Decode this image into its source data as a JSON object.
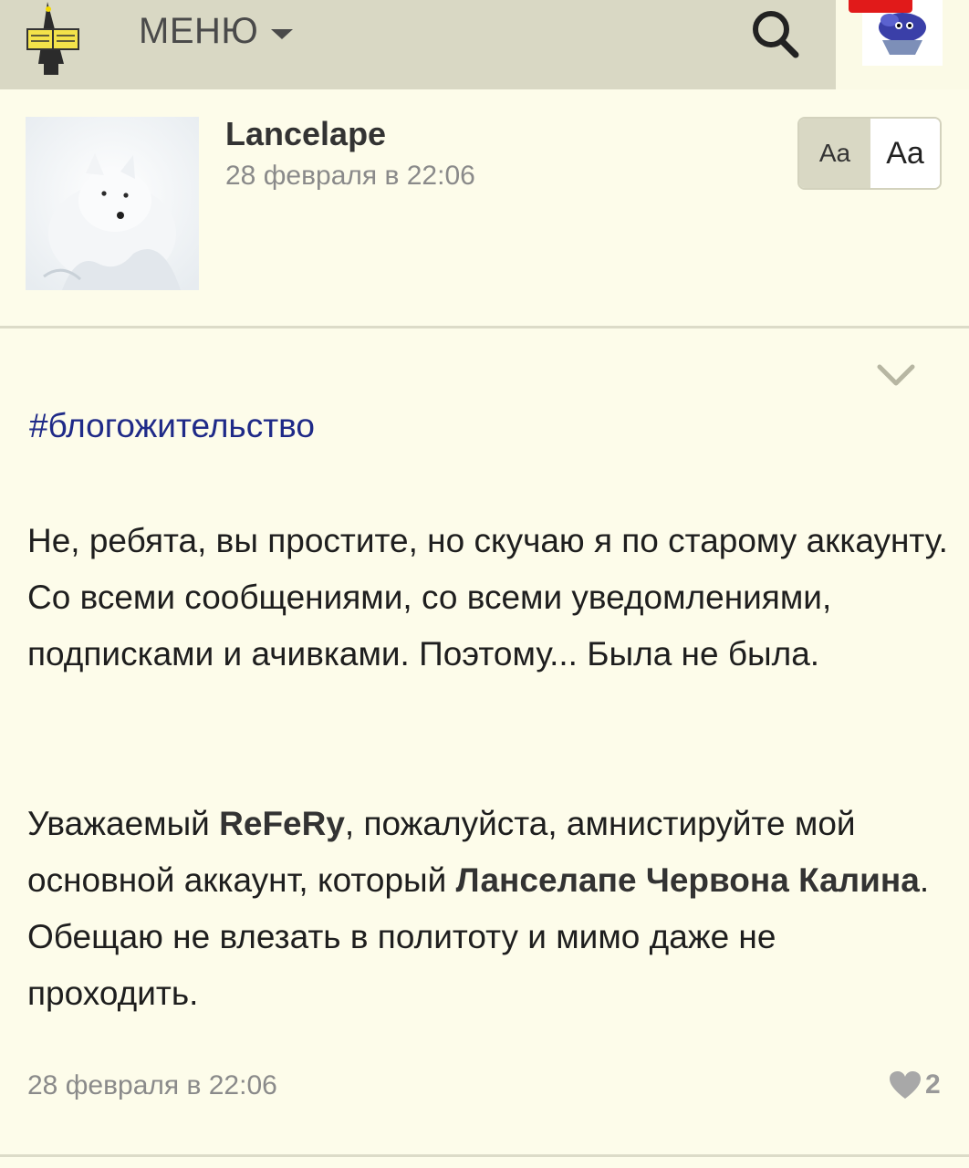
{
  "header": {
    "menu_label": "МЕНЮ",
    "icons": {
      "logo": "wizard-reading-logo-icon",
      "menu_caret": "chevron-down-icon",
      "search": "search-icon",
      "user_avatar": "user-avatar-icon"
    },
    "colors": {
      "bar": "#d9d8c4",
      "badge": "#e11a1a"
    }
  },
  "post": {
    "author": "Lancelape",
    "date": "28 февраля в 22:06",
    "font_toggle": {
      "small": "Aa",
      "large": "Aa",
      "selected": "large"
    },
    "hashtag": "#блогожительство",
    "paragraph1": "Не, ребята, вы простите, но скучаю я по старому аккаунту. Со всеми сообщениями, со всеми уведомлениями, подписками и ачивками. Поэтому... Была не была.",
    "paragraph2": {
      "part1": "Уважаемый ",
      "mention1": "ReFeRy",
      "part2": ", пожалуйста, амнистируйте мой основной аккаунт, который ",
      "mention2": "Ланселапе Червона Калина",
      "part3": ". Обещаю не влезать в политоту и мимо даже не проходить."
    },
    "footer_date": "28 февраля в 22:06",
    "likes": "2"
  },
  "colors": {
    "background": "#fdfcea",
    "hashtag": "#1f2a88",
    "muted_text": "#8a8a8a"
  }
}
